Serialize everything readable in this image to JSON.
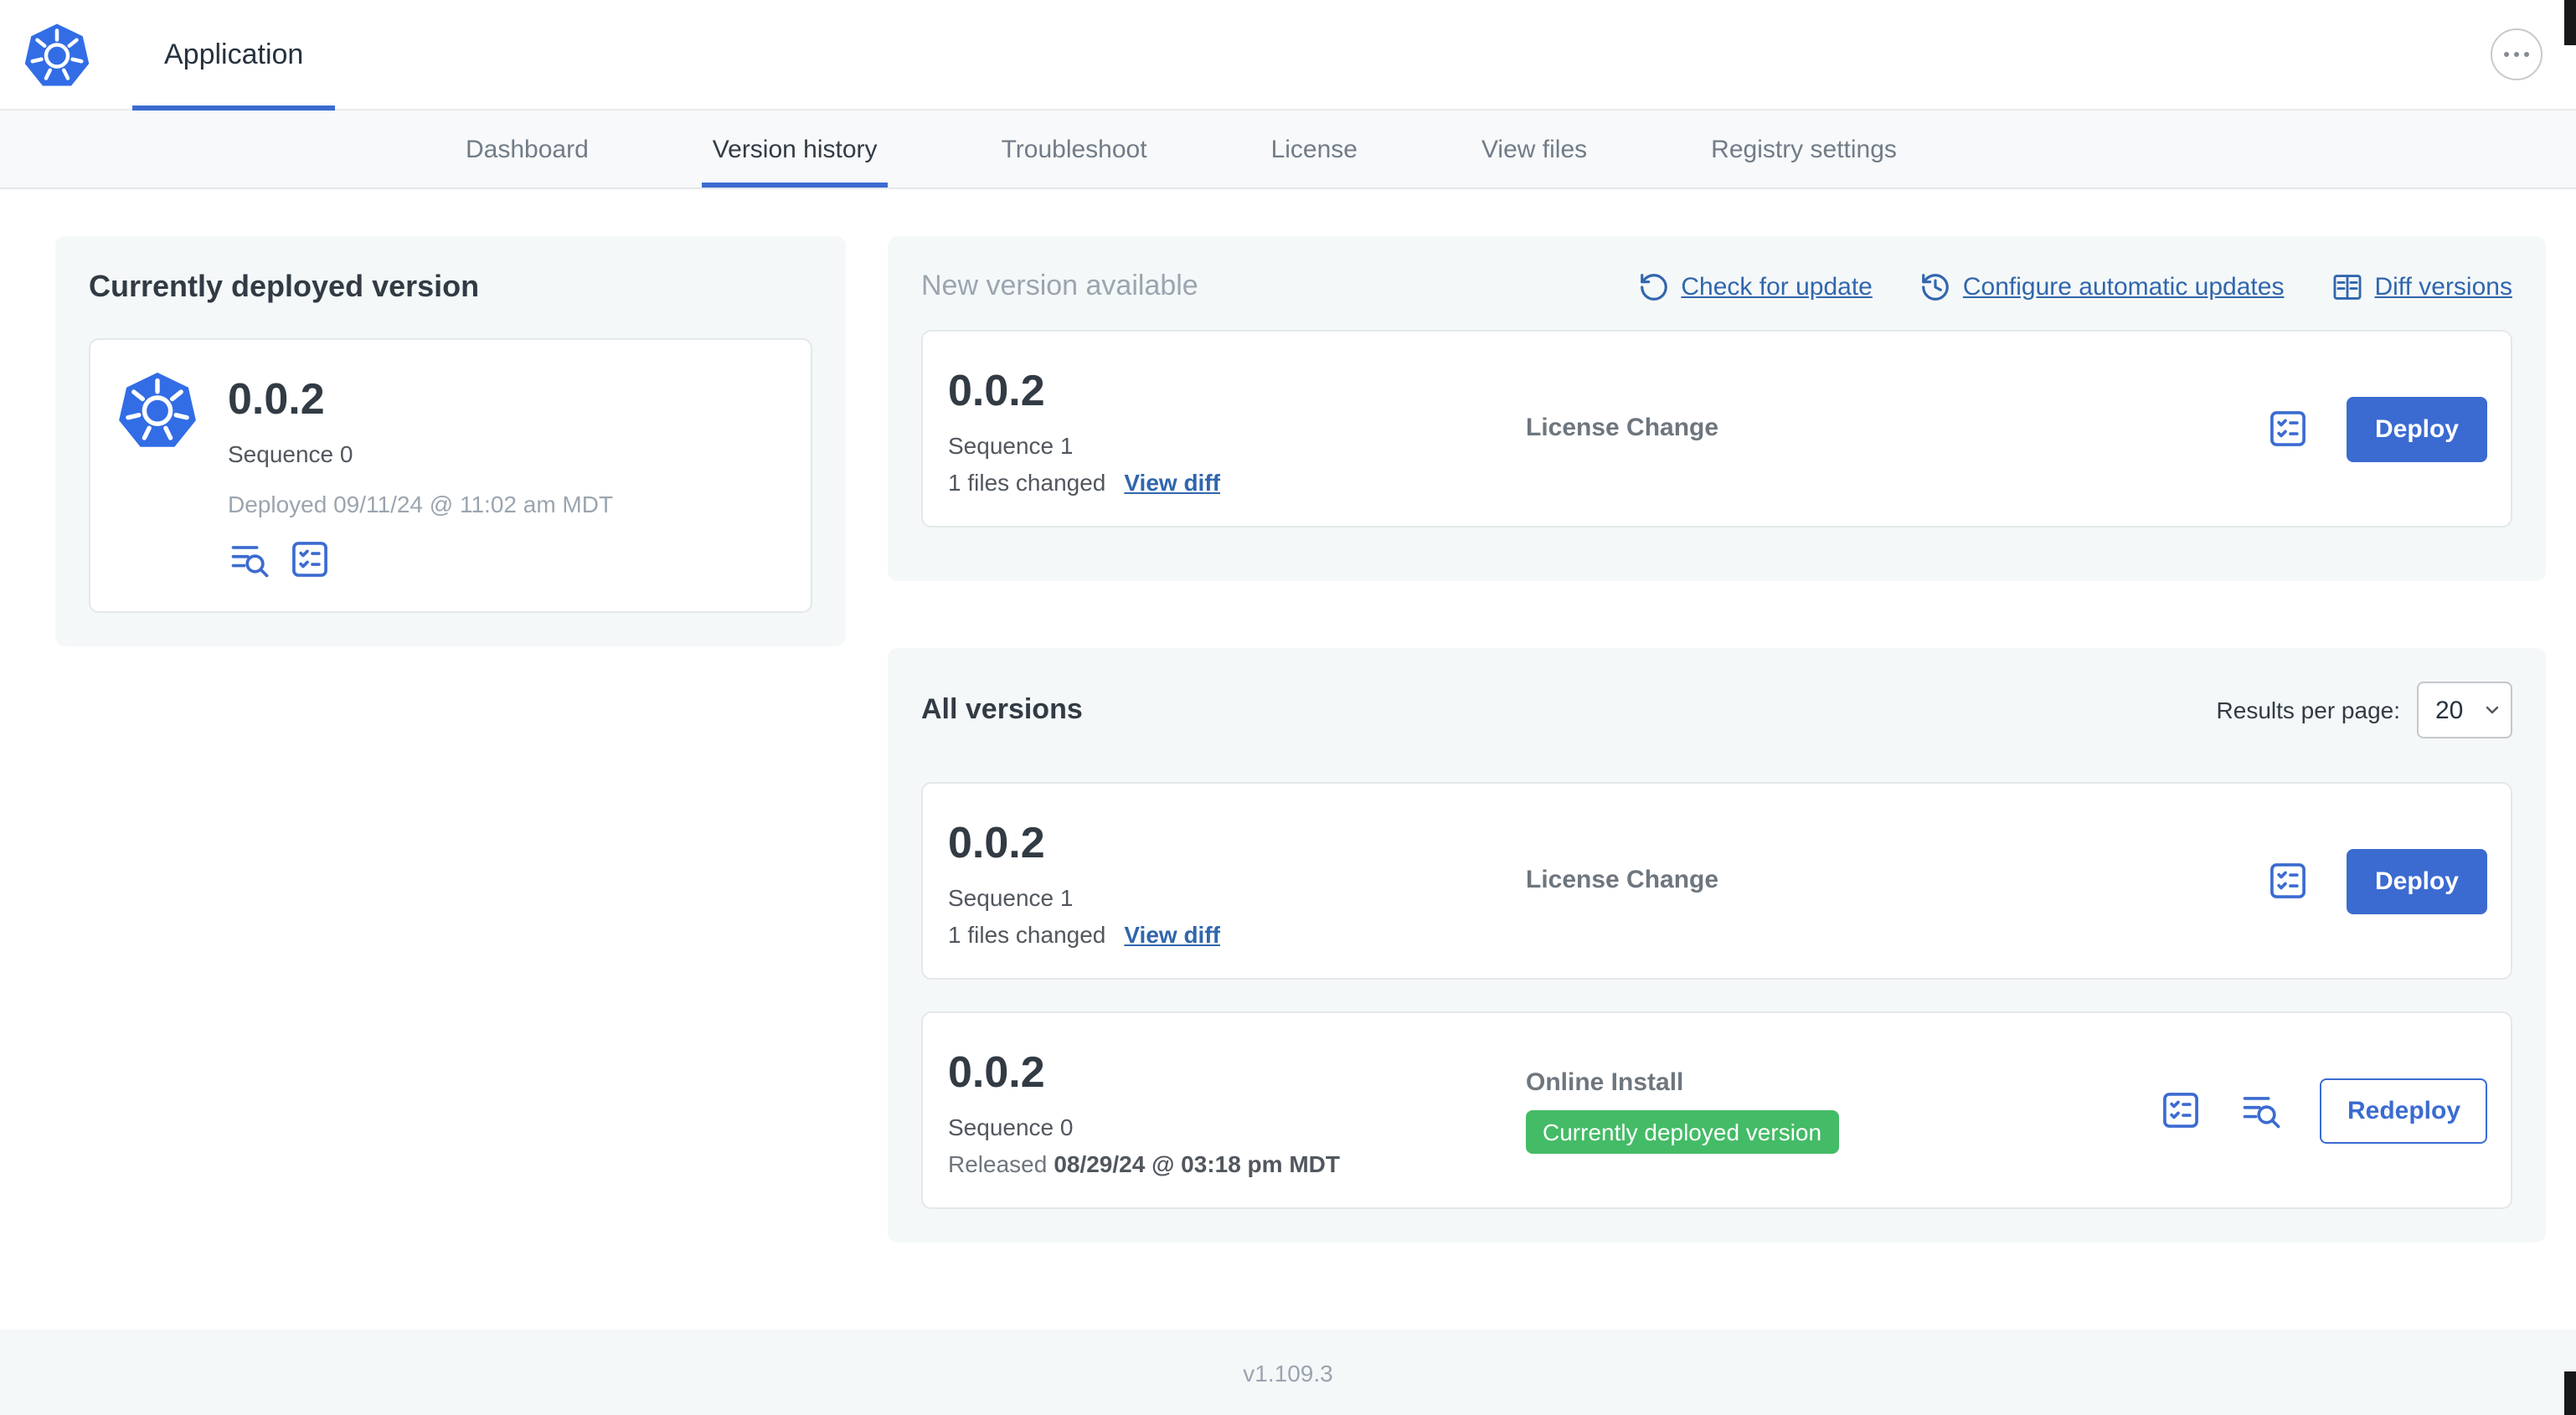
{
  "colors": {
    "primary_blue": "#3b6bd1",
    "link_blue": "#3066ad",
    "badge_green": "#44bb66",
    "panel_gray": "#f5f8f9",
    "muted_text": "#9ba5af"
  },
  "topbar": {
    "app_tab_label": "Application"
  },
  "nav": {
    "active_tab": "Version history",
    "tabs": [
      {
        "label": "Dashboard"
      },
      {
        "label": "Version history"
      },
      {
        "label": "Troubleshoot"
      },
      {
        "label": "License"
      },
      {
        "label": "View files"
      },
      {
        "label": "Registry settings"
      }
    ]
  },
  "current_version": {
    "title": "Currently deployed version",
    "version": "0.0.2",
    "sequence": "Sequence 0",
    "deployed": "Deployed 09/11/24 @ 11:02 am MDT"
  },
  "new_version": {
    "title": "New version available",
    "check_for_update": "Check for update",
    "configure_automatic_updates": "Configure automatic updates",
    "diff_versions": "Diff versions",
    "card": {
      "version": "0.0.2",
      "sequence": "Sequence 1",
      "files_changed": "1 files changed",
      "view_diff": "View diff",
      "source": "License Change",
      "deploy": "Deploy"
    }
  },
  "all_versions": {
    "title": "All versions",
    "results_per_page_label": "Results per page:",
    "results_per_page": "20",
    "rows": [
      {
        "version": "0.0.2",
        "sequence": "Sequence 1",
        "files_changed": "1 files changed",
        "view_diff": "View diff",
        "source": "License Change",
        "action": "Deploy"
      },
      {
        "version": "0.0.2",
        "sequence": "Sequence 0",
        "released_prefix": "Released",
        "released_date": "08/29/24 @ 03:18 pm MDT",
        "source": "Online Install",
        "badge": "Currently deployed version",
        "action": "Redeploy"
      }
    ]
  },
  "footer": {
    "app_version": "v1.109.3"
  }
}
